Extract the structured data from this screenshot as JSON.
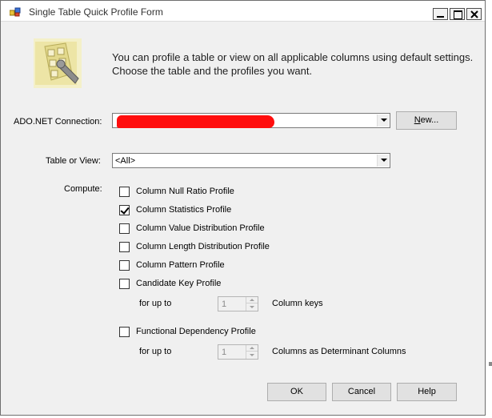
{
  "window": {
    "title": "Single Table Quick Profile Form",
    "icon": "profile-form-app-icon",
    "controls": [
      "minimize-icon",
      "maximize-icon",
      "close-icon"
    ]
  },
  "header": {
    "image": "profile-wizard-image",
    "intro": "You can profile a table or view on all applicable columns using default settings. Choose the table and the profiles you want."
  },
  "connection": {
    "label": "ADO.NET Connection:",
    "value": "",
    "redacted": true,
    "redaction_color": "#ff0d0d",
    "new_button": "New..."
  },
  "table": {
    "label": "Table or View:",
    "value": "<All>"
  },
  "compute": {
    "label": "Compute:",
    "profiles": [
      {
        "label": "Column Null Ratio Profile",
        "checked": false
      },
      {
        "label": "Column Statistics Profile",
        "checked": true
      },
      {
        "label": "Column Value Distribution Profile",
        "checked": false
      },
      {
        "label": "Column Length Distribution Profile",
        "checked": false
      },
      {
        "label": "Column Pattern Profile",
        "checked": false
      },
      {
        "label": "Candidate Key Profile",
        "checked": false
      }
    ],
    "candidate_key": {
      "for_up_to": "for up to",
      "value": "1",
      "suffix": "Column keys",
      "enabled": false
    },
    "functional_dependency": {
      "label": "Functional Dependency Profile",
      "checked": false,
      "for_up_to": "for up to",
      "value": "1",
      "suffix": "Columns as Determinant Columns",
      "enabled": false
    }
  },
  "buttons": {
    "ok": "OK",
    "cancel": "Cancel",
    "help": "Help"
  }
}
